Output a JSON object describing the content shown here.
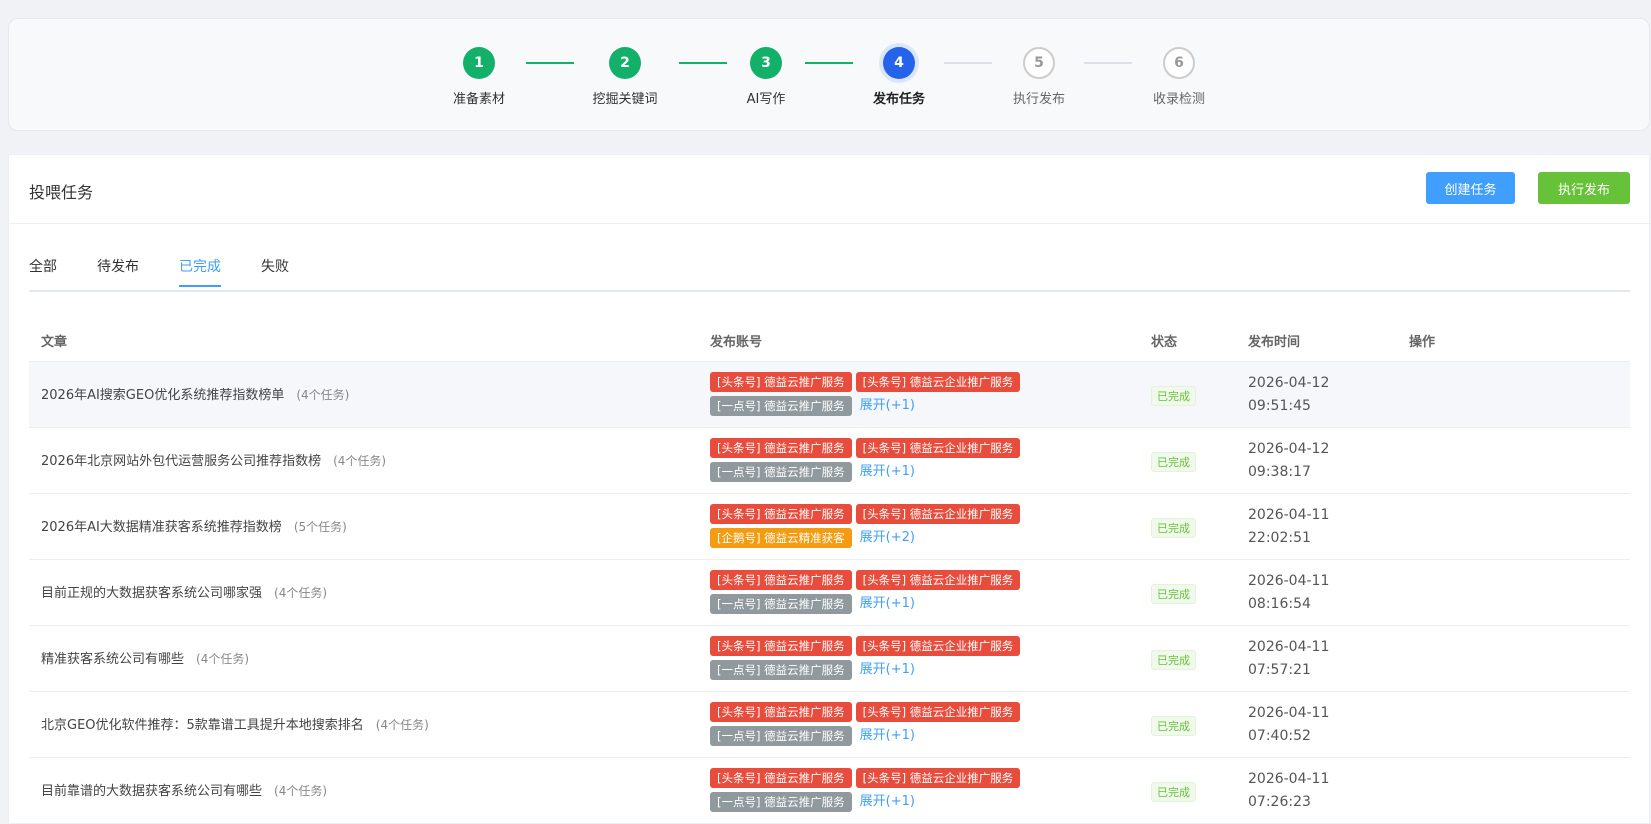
{
  "steps": [
    {
      "num": "1",
      "label": "准备素材",
      "state": "done"
    },
    {
      "num": "2",
      "label": "挖掘关键词",
      "state": "done"
    },
    {
      "num": "3",
      "label": "AI写作",
      "state": "done"
    },
    {
      "num": "4",
      "label": "发布任务",
      "state": "active"
    },
    {
      "num": "5",
      "label": "执行发布",
      "state": "todo"
    },
    {
      "num": "6",
      "label": "收录检测",
      "state": "todo"
    }
  ],
  "header": {
    "title": "投喂任务",
    "create_label": "创建任务",
    "exec_label": "执行发布"
  },
  "tabs": [
    {
      "label": "全部",
      "active": false
    },
    {
      "label": "待发布",
      "active": false
    },
    {
      "label": "已完成",
      "active": true
    },
    {
      "label": "失败",
      "active": false
    }
  ],
  "table": {
    "columns": [
      "文章",
      "发布账号",
      "状态",
      "发布时间",
      "操作"
    ],
    "rows": [
      {
        "title": "2026年AI搜索GEO优化系统推荐指数榜单",
        "count": "(4个任务)",
        "tags": [
          {
            "text": "[头条号] 德益云推广服务",
            "color": "red"
          },
          {
            "text": "[头条号] 德益云企业推广服务",
            "color": "red"
          },
          {
            "text": "[一点号] 德益云推广服务",
            "color": "gray"
          }
        ],
        "expand": "展开(+1)",
        "status": "已完成",
        "date": "2026-04-12",
        "time": "09:51:45"
      },
      {
        "title": "2026年北京网站外包代运营服务公司推荐指数榜",
        "count": "(4个任务)",
        "tags": [
          {
            "text": "[头条号] 德益云推广服务",
            "color": "red"
          },
          {
            "text": "[头条号] 德益云企业推广服务",
            "color": "red"
          },
          {
            "text": "[一点号] 德益云推广服务",
            "color": "gray"
          }
        ],
        "expand": "展开(+1)",
        "status": "已完成",
        "date": "2026-04-12",
        "time": "09:38:17"
      },
      {
        "title": "2026年AI大数据精准获客系统推荐指数榜",
        "count": "(5个任务)",
        "tags": [
          {
            "text": "[头条号] 德益云推广服务",
            "color": "red"
          },
          {
            "text": "[头条号] 德益云企业推广服务",
            "color": "red"
          },
          {
            "text": "[企鹅号] 德益云精准获客",
            "color": "orange"
          }
        ],
        "expand": "展开(+2)",
        "status": "已完成",
        "date": "2026-04-11",
        "time": "22:02:51"
      },
      {
        "title": "目前正规的大数据获客系统公司哪家强",
        "count": "(4个任务)",
        "tags": [
          {
            "text": "[头条号] 德益云推广服务",
            "color": "red"
          },
          {
            "text": "[头条号] 德益云企业推广服务",
            "color": "red"
          },
          {
            "text": "[一点号] 德益云推广服务",
            "color": "gray"
          }
        ],
        "expand": "展开(+1)",
        "status": "已完成",
        "date": "2026-04-11",
        "time": "08:16:54"
      },
      {
        "title": "精准获客系统公司有哪些",
        "count": "(4个任务)",
        "tags": [
          {
            "text": "[头条号] 德益云推广服务",
            "color": "red"
          },
          {
            "text": "[头条号] 德益云企业推广服务",
            "color": "red"
          },
          {
            "text": "[一点号] 德益云推广服务",
            "color": "gray"
          }
        ],
        "expand": "展开(+1)",
        "status": "已完成",
        "date": "2026-04-11",
        "time": "07:57:21"
      },
      {
        "title": "北京GEO优化软件推荐：5款靠谱工具提升本地搜索排名",
        "count": "(4个任务)",
        "tags": [
          {
            "text": "[头条号] 德益云推广服务",
            "color": "red"
          },
          {
            "text": "[头条号] 德益云企业推广服务",
            "color": "red"
          },
          {
            "text": "[一点号] 德益云推广服务",
            "color": "gray"
          }
        ],
        "expand": "展开(+1)",
        "status": "已完成",
        "date": "2026-04-11",
        "time": "07:40:52"
      },
      {
        "title": "目前靠谱的大数据获客系统公司有哪些",
        "count": "(4个任务)",
        "tags": [
          {
            "text": "[头条号] 德益云推广服务",
            "color": "red"
          },
          {
            "text": "[头条号] 德益云企业推广服务",
            "color": "red"
          },
          {
            "text": "[一点号] 德益云推广服务",
            "color": "gray"
          }
        ],
        "expand": "展开(+1)",
        "status": "已完成",
        "date": "2026-04-11",
        "time": "07:26:23"
      }
    ]
  }
}
